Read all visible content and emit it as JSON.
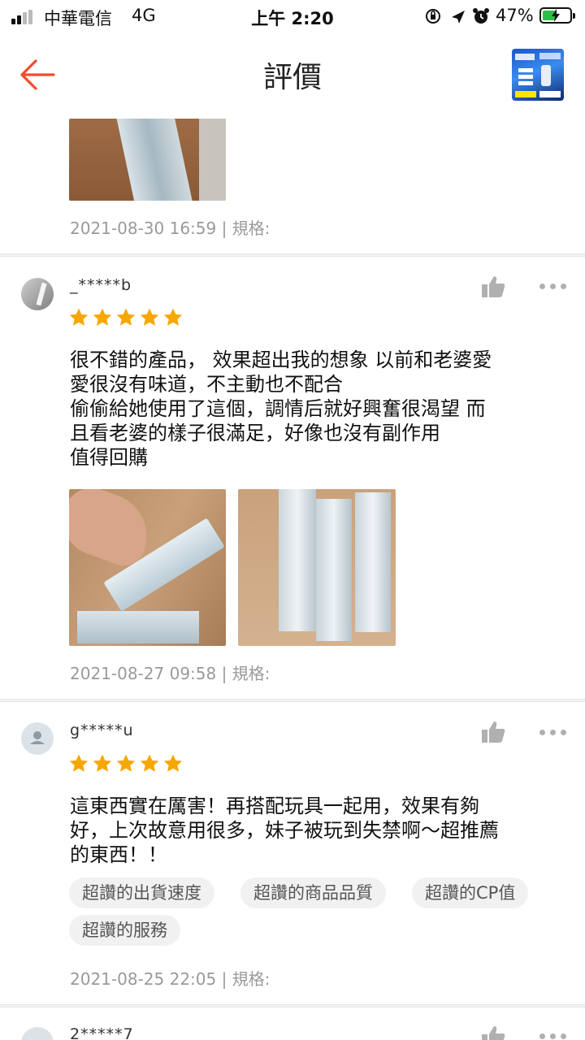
{
  "status_bar": {
    "carrier": "中華電信",
    "network": "4G",
    "time": "上午 2:20",
    "battery": "47%"
  },
  "header": {
    "title": "評價",
    "back_icon": "back-arrow-icon",
    "accent_color": "#ee4d2d"
  },
  "previous_review": {
    "meta": "2021-08-30 16:59 | 規格:"
  },
  "reviews": [
    {
      "username": "_*****b",
      "rating": 5,
      "text_lines": [
        "很不錯的產品，  效果超出我的想象  以前和老婆愛",
        "愛很沒有味道，不主動也不配合",
        "偷偷給她使用了這個，調情后就好興奮很渴望  而",
        "且看老婆的樣子很滿足，好像也沒有副作用",
        "值得回購"
      ],
      "meta": "2021-08-27 09:58 | 規格:"
    },
    {
      "username": "g*****u",
      "rating": 5,
      "text_lines": [
        "這東西實在厲害！再搭配玩具一起用，效果有夠",
        "好，上次故意用很多，妹子被玩到失禁啊～超推薦",
        "的東西！！"
      ],
      "tags": [
        "超讚的出貨速度",
        "超讚的商品品質",
        "超讚的CP值",
        "超讚的服務"
      ],
      "meta": "2021-08-25 22:05 | 規格:"
    },
    {
      "username": "2*****7"
    }
  ],
  "colors": {
    "star": "#f6a700",
    "meta_text": "#9a9a9a",
    "tag_bg": "#f1f1f1"
  }
}
